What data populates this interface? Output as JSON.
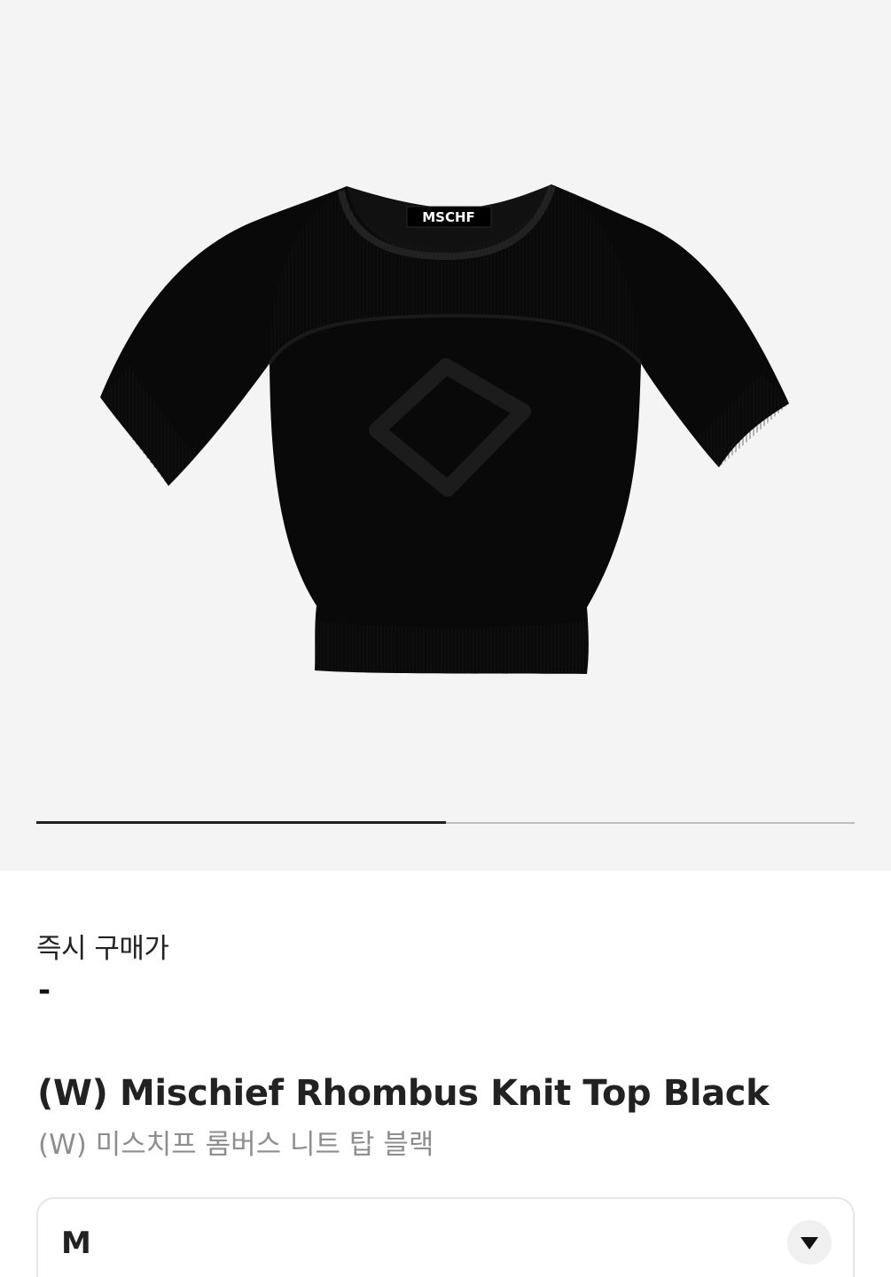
{
  "product_image": {
    "icon": "knit-top-image",
    "brand_label": "MSCHF"
  },
  "gallery": {
    "progress": 0.5
  },
  "price": {
    "label": "즉시 구매가",
    "value": "-"
  },
  "product": {
    "name_en": "(W) Mischief Rhombus Knit Top Black",
    "name_ko": "(W) 미스치프 롬버스 니트 탑 블랙"
  },
  "size_select": {
    "value": "M",
    "icon": "chevron-down-icon"
  },
  "colors": {
    "hero_bg": "#f4f4f4",
    "garment": "#090909",
    "progress_active": "#1f1f1f",
    "progress_track": "#bdbdbd",
    "subtitle": "#8e8e8e"
  }
}
